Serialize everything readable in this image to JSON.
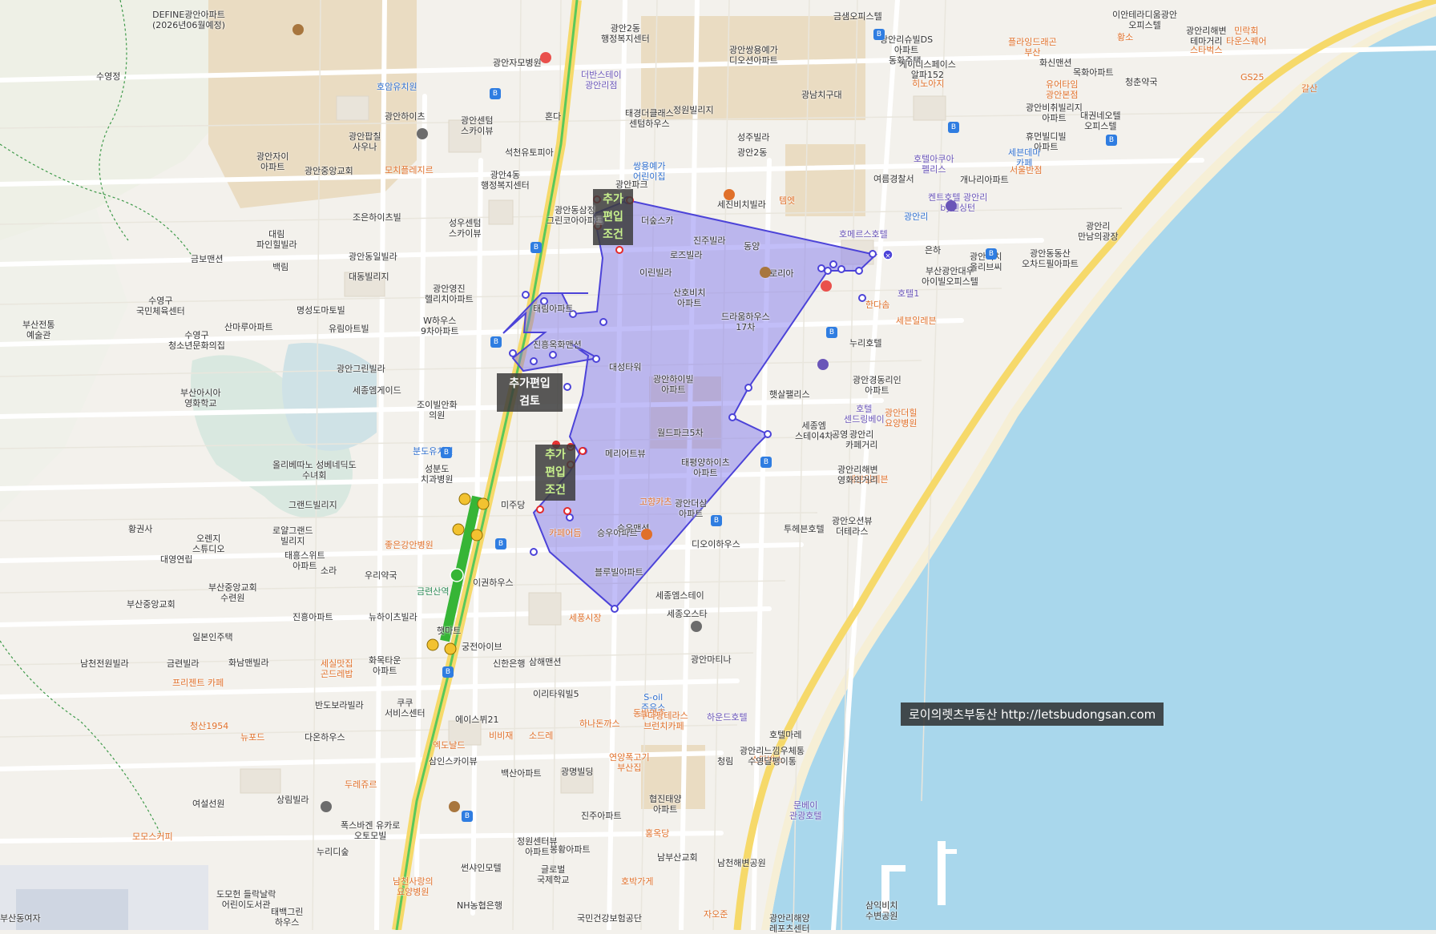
{
  "tags": {
    "north": "추가\n편입\n조건",
    "west": "추가편입\n검토",
    "south": "추가\n편입\n조건"
  },
  "watermark": "로이의렛츠부동산 http://letsbudongsan.com",
  "labels": [
    {
      "t": "DEFINE광안아파트\n(2026년06월예정)",
      "c": ""
    },
    {
      "t": "수영정",
      "c": ""
    },
    {
      "t": "호암유치원",
      "c": "blue"
    },
    {
      "t": "광안자모병원",
      "c": ""
    },
    {
      "t": "광안하이츠",
      "c": ""
    },
    {
      "t": "광안센텀\n스카이뷰",
      "c": ""
    },
    {
      "t": "혼다",
      "c": ""
    },
    {
      "t": "광안팝칠\n사우나",
      "c": ""
    },
    {
      "t": "광안자이\n아파트",
      "c": ""
    },
    {
      "t": "광안중앙교회",
      "c": ""
    },
    {
      "t": "모치플레지르",
      "c": "orange"
    },
    {
      "t": "석천유토피아",
      "c": ""
    },
    {
      "t": "광안4동\n행정복지센터",
      "c": ""
    },
    {
      "t": "조은하이츠빌",
      "c": ""
    },
    {
      "t": "성우센텀\n스카이뷰",
      "c": ""
    },
    {
      "t": "대림\n파인힐빌라",
      "c": ""
    },
    {
      "t": "금보맨션",
      "c": ""
    },
    {
      "t": "광안동일빌라",
      "c": ""
    },
    {
      "t": "대동빌리지",
      "c": ""
    },
    {
      "t": "백림",
      "c": ""
    },
    {
      "t": "광안영진\n헬리치아파트",
      "c": ""
    },
    {
      "t": "수영구\n국민체육센터",
      "c": ""
    },
    {
      "t": "명성도마토빌",
      "c": ""
    },
    {
      "t": "W하우스\n9차아파트",
      "c": ""
    },
    {
      "t": "수영구\n청소년문화의집",
      "c": ""
    },
    {
      "t": "산마루아파트",
      "c": ""
    },
    {
      "t": "유림아트빌",
      "c": ""
    },
    {
      "t": "부산전통\n예술관",
      "c": ""
    },
    {
      "t": "광안그린빌라",
      "c": ""
    },
    {
      "t": "부산아시아\n영화학교",
      "c": ""
    },
    {
      "t": "세종엠게이드",
      "c": ""
    },
    {
      "t": "조이빌안화\n의원",
      "c": ""
    },
    {
      "t": "분도유치원",
      "c": "blue"
    },
    {
      "t": "올리베따노 성베네딕도\n수녀회",
      "c": ""
    },
    {
      "t": "성분도\n치과병원",
      "c": ""
    },
    {
      "t": "그랜드빌리지",
      "c": ""
    },
    {
      "t": "황권사",
      "c": ""
    },
    {
      "t": "오렌지\n스튜디오",
      "c": ""
    },
    {
      "t": "로얄그랜드\n빌리지",
      "c": ""
    },
    {
      "t": "대영연립",
      "c": ""
    },
    {
      "t": "태흥스위트\n아파트",
      "c": ""
    },
    {
      "t": "소라",
      "c": ""
    },
    {
      "t": "우리약국",
      "c": ""
    },
    {
      "t": "좋은강안병원",
      "c": "orange"
    },
    {
      "t": "부산중앙교회\n수련원",
      "c": ""
    },
    {
      "t": "부산중앙교회",
      "c": ""
    },
    {
      "t": "금련산역",
      "c": "green"
    },
    {
      "t": "이권하우스",
      "c": ""
    },
    {
      "t": "진흥아파트",
      "c": ""
    },
    {
      "t": "뉴하이츠빌라",
      "c": ""
    },
    {
      "t": "일본인주택",
      "c": ""
    },
    {
      "t": "햇마트",
      "c": ""
    },
    {
      "t": "궁전아이브",
      "c": ""
    },
    {
      "t": "남천전원빌라",
      "c": ""
    },
    {
      "t": "금련빌라",
      "c": ""
    },
    {
      "t": "세실맛집\n곤드레밥",
      "c": "orange"
    },
    {
      "t": "화남맨빌라",
      "c": ""
    },
    {
      "t": "화목타운\n아파트",
      "c": ""
    },
    {
      "t": "신한은행",
      "c": ""
    },
    {
      "t": "삼해맨션",
      "c": ""
    },
    {
      "t": "프리젠트 카페",
      "c": "orange"
    },
    {
      "t": "쿠쿠\n서비스센터",
      "c": ""
    },
    {
      "t": "반도보라빌라",
      "c": ""
    },
    {
      "t": "이리타워빌5",
      "c": ""
    },
    {
      "t": "청산1954",
      "c": "orange"
    },
    {
      "t": "에이스뷔21",
      "c": ""
    },
    {
      "t": "하나돈까스",
      "c": "orange"
    },
    {
      "t": "뉴포드",
      "c": "orange"
    },
    {
      "t": "다온하우스",
      "c": ""
    },
    {
      "t": "엑도날드",
      "c": "orange"
    },
    {
      "t": "비비재",
      "c": "orange"
    },
    {
      "t": "소드레",
      "c": "orange"
    },
    {
      "t": "삼인스카이뷰",
      "c": ""
    },
    {
      "t": "연양폭고기\n부산집",
      "c": "orange"
    },
    {
      "t": "백산아파트",
      "c": ""
    },
    {
      "t": "광명빌딩",
      "c": ""
    },
    {
      "t": "두레쥬르",
      "c": "orange"
    },
    {
      "t": "상림빌라",
      "c": ""
    },
    {
      "t": "여설선원",
      "c": ""
    },
    {
      "t": "협진태양\n아파트",
      "c": ""
    },
    {
      "t": "폭스바겐 유카로\n오토모빌",
      "c": ""
    },
    {
      "t": "진주아파트",
      "c": ""
    },
    {
      "t": "모모스커피",
      "c": "orange"
    },
    {
      "t": "누리디숲",
      "c": ""
    },
    {
      "t": "정원센터뷰\n아파트",
      "c": ""
    },
    {
      "t": "봉황아파트",
      "c": ""
    },
    {
      "t": "홍옥당",
      "c": "orange"
    },
    {
      "t": "썬샤인모텔",
      "c": ""
    },
    {
      "t": "글로벌\n국제학교",
      "c": ""
    },
    {
      "t": "남부산교회",
      "c": ""
    },
    {
      "t": "남천해변공원",
      "c": ""
    },
    {
      "t": "남천사랑의\n요양병원",
      "c": "orange"
    },
    {
      "t": "호박가게",
      "c": "orange"
    },
    {
      "t": "도모헌 들락날락\n어린이도서관",
      "c": ""
    },
    {
      "t": "태백그린\n하우스",
      "c": ""
    },
    {
      "t": "NH농협은행",
      "c": ""
    },
    {
      "t": "국민건강보험공단",
      "c": ""
    },
    {
      "t": "자오준",
      "c": "orange"
    },
    {
      "t": "광안리해양\n레포츠센터",
      "c": ""
    },
    {
      "t": "삼익비치\n수변공원",
      "c": ""
    },
    {
      "t": "부산동여자",
      "c": ""
    },
    {
      "t": "광안2동\n행정복지센터",
      "c": ""
    },
    {
      "t": "더반스테이\n광안리점",
      "c": "purple"
    },
    {
      "t": "태경더클래스\n센텀하우스",
      "c": ""
    },
    {
      "t": "정원빌리지",
      "c": ""
    },
    {
      "t": "광안쌍용예가\n디오션아파트",
      "c": ""
    },
    {
      "t": "성주빌라",
      "c": ""
    },
    {
      "t": "광안2동",
      "c": ""
    },
    {
      "t": "광남치구대",
      "c": ""
    },
    {
      "t": "쌍용예가\n어린이집",
      "c": "blue"
    },
    {
      "t": "광안파크",
      "c": ""
    },
    {
      "t": "세진비치빌라",
      "c": ""
    },
    {
      "t": "템엣",
      "c": "orange"
    },
    {
      "t": "광안동삼정\n그린코아아파트",
      "c": ""
    },
    {
      "t": "더숲스카",
      "c": ""
    },
    {
      "t": "진주빌라",
      "c": ""
    },
    {
      "t": "동양",
      "c": ""
    },
    {
      "t": "로즈빌라",
      "c": ""
    },
    {
      "t": "이린빌라",
      "c": ""
    },
    {
      "t": "글로리아",
      "c": ""
    },
    {
      "t": "산호비치\n아파트",
      "c": ""
    },
    {
      "t": "드라움하우스\n17차",
      "c": ""
    },
    {
      "t": "태림아파트",
      "c": ""
    },
    {
      "t": "진흥옥화맨션",
      "c": ""
    },
    {
      "t": "대성타워",
      "c": ""
    },
    {
      "t": "광안하이빌\n아파트",
      "c": ""
    },
    {
      "t": "햇살팰리스",
      "c": ""
    },
    {
      "t": "세종엠\n스테이4차",
      "c": ""
    },
    {
      "t": "월드파크5차",
      "c": ""
    },
    {
      "t": "메리어트뷰",
      "c": ""
    },
    {
      "t": "태평양하이츠\n아파트",
      "c": ""
    },
    {
      "t": "미주당",
      "c": ""
    },
    {
      "t": "고향카츠",
      "c": "orange"
    },
    {
      "t": "광안더삼\n아파트",
      "c": ""
    },
    {
      "t": "승우아파트",
      "c": ""
    },
    {
      "t": "승우맨션",
      "c": ""
    },
    {
      "t": "디오이하우스",
      "c": ""
    },
    {
      "t": "카페어듬",
      "c": "orange"
    },
    {
      "t": "블루빌아파트",
      "c": ""
    },
    {
      "t": "세풍시장",
      "c": "orange"
    },
    {
      "t": "세종오스타",
      "c": ""
    },
    {
      "t": "세종엠스테이",
      "c": ""
    },
    {
      "t": "광안마티나",
      "c": ""
    },
    {
      "t": "S-oil\n주유소",
      "c": "blue"
    },
    {
      "t": "동방명주",
      "c": "orange"
    },
    {
      "t": "하운드호텔",
      "c": "purple"
    },
    {
      "t": "호텔마레",
      "c": ""
    },
    {
      "t": "쿠다팡테라스\n브런치카페",
      "c": "orange"
    },
    {
      "t": "청림",
      "c": ""
    },
    {
      "t": "스타벅스",
      "c": "orange"
    },
    {
      "t": "광안리느낌우체통\n수영달팽이통",
      "c": ""
    },
    {
      "t": "투헤븐호텔",
      "c": ""
    },
    {
      "t": "광안오션뷰\n더테라스",
      "c": ""
    },
    {
      "t": "세븐일레븐",
      "c": "orange"
    },
    {
      "t": "문베이\n관광호텔",
      "c": "purple"
    },
    {
      "t": "광안리해변\n영화의거리",
      "c": ""
    },
    {
      "t": "광안리\n카페거리",
      "c": ""
    },
    {
      "t": "공영",
      "c": ""
    },
    {
      "t": "호텔\n센드링베이",
      "c": "purple"
    },
    {
      "t": "누리호텔",
      "c": ""
    },
    {
      "t": "광안경동리인\n아파트",
      "c": ""
    },
    {
      "t": "광안더힐\n요양병원",
      "c": "orange"
    },
    {
      "t": "한다솜",
      "c": "orange"
    },
    {
      "t": "호텔1",
      "c": "purple"
    },
    {
      "t": "세븐일레븐",
      "c": "orange"
    },
    {
      "t": "부산광안대우\n아이빌오피스텔",
      "c": ""
    },
    {
      "t": "은하",
      "c": ""
    },
    {
      "t": "호메르스호텔",
      "c": "purple"
    },
    {
      "t": "광안리",
      "c": "blue"
    },
    {
      "t": "개나리아파트",
      "c": ""
    },
    {
      "t": "여름경찰서",
      "c": ""
    },
    {
      "t": "호텔아쿠아\n펠리스",
      "c": "purple"
    },
    {
      "t": "광안비치\n올리브씨",
      "c": ""
    },
    {
      "t": "광안동동산\n오차드필아파트",
      "c": ""
    },
    {
      "t": "광안리\n만남의광장",
      "c": ""
    },
    {
      "t": "켄트호텔 광안리\nby켄싱턴",
      "c": "purple"
    },
    {
      "t": "세븐데마\n카페",
      "c": "blue"
    },
    {
      "t": "서울반점",
      "c": "orange"
    },
    {
      "t": "휴먼빌디빌\n아파트",
      "c": ""
    },
    {
      "t": "대권네오텔\n오피스텔",
      "c": ""
    },
    {
      "t": "청춘약국",
      "c": ""
    },
    {
      "t": "유어타임\n광안본점",
      "c": "orange"
    },
    {
      "t": "광안비취빌리지\n아파트",
      "c": ""
    },
    {
      "t": "히노아지",
      "c": "orange"
    },
    {
      "t": "케이디스페이스\n알파152",
      "c": ""
    },
    {
      "t": "광안리슈빌DS\n아파트",
      "c": ""
    },
    {
      "t": "동화주택",
      "c": ""
    },
    {
      "t": "금샘오피스텔",
      "c": ""
    },
    {
      "t": "플라잉드래곤\n부산",
      "c": "orange"
    },
    {
      "t": "화신맨션",
      "c": ""
    },
    {
      "t": "목화아파트",
      "c": ""
    },
    {
      "t": "황소",
      "c": "orange"
    },
    {
      "t": "스타벅스",
      "c": "orange"
    },
    {
      "t": "이안테라디움광안\n오피스텔",
      "c": ""
    },
    {
      "t": "광안리해변\n테마거리",
      "c": ""
    },
    {
      "t": "민락회\n타운스퀘어",
      "c": "orange"
    },
    {
      "t": "갈산",
      "c": "orange"
    },
    {
      "t": "GS25",
      "c": "orange"
    }
  ]
}
